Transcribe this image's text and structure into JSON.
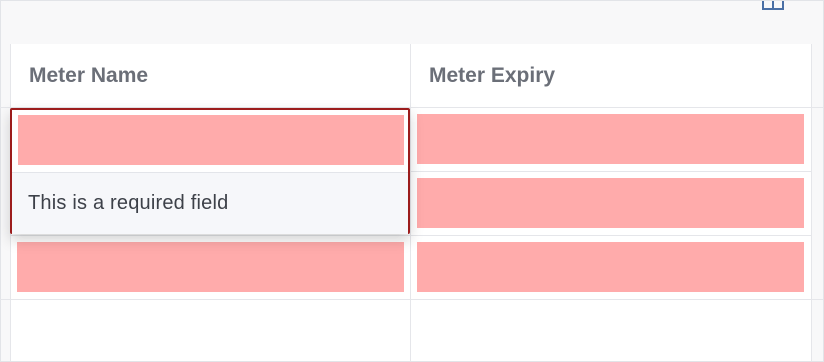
{
  "table": {
    "columns": [
      {
        "label": "Meter Name"
      },
      {
        "label": "Meter Expiry"
      }
    ]
  },
  "validation": {
    "message": "This is a required field"
  },
  "colors": {
    "error_fill": "#ffabab",
    "error_border": "#9c1c1c",
    "header_text": "#6b6f78"
  },
  "icons": {
    "toolbar": "columns-icon"
  }
}
